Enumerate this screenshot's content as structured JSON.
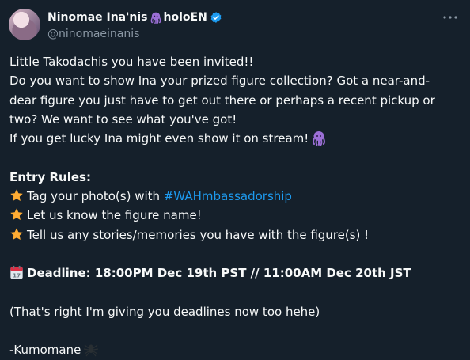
{
  "author": {
    "name": "Ninomae Ina'nis",
    "name_suffix": "holoEN",
    "handle": "@ninomaeinanis",
    "verified": true,
    "name_icon": "octopus-icon"
  },
  "post": {
    "line1": "Little Takodachis you have been invited!!",
    "line2": "Do you want to show Ina your prized figure collection? Got a near-and-",
    "line3": "dear figure you just have to get out there or perhaps a recent pickup or",
    "line4": "two? We want to see what you've got!",
    "line5": "If you get lucky Ina might even show it on stream!",
    "rules_title": "Entry Rules:",
    "rule1_prefix": "Tag your photo(s) with ",
    "rule1_hashtag": "#WAHmbassadorship",
    "rule2": "Let us know the figure name!",
    "rule3": "Tell us any stories/memories you have with the figure(s) !",
    "deadline": "Deadline: 18:00PM Dec 19th PST // 11:00AM Dec 20th JST",
    "note": "(That's right I'm giving you deadlines now too hehe)",
    "signature": "-Kumomane"
  },
  "icons": {
    "rule_bullet": "star-icon",
    "deadline_icon": "calendar-icon",
    "signature_icon": "spider-icon",
    "more_icon": "more-horizontal-icon"
  },
  "colors": {
    "background": "#15202b",
    "text": "#f7f9f9",
    "secondary": "#8b98a5",
    "link": "#1d9bf0",
    "octopus": "#9b6fd6"
  }
}
